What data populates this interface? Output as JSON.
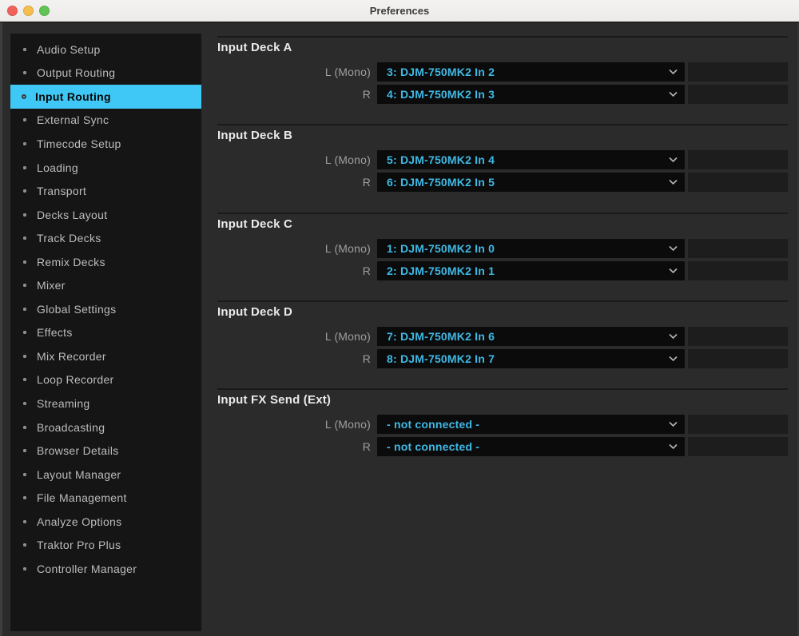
{
  "window": {
    "title": "Preferences"
  },
  "titlebar": {
    "buttons": [
      {
        "name": "close"
      },
      {
        "name": "minimize"
      },
      {
        "name": "zoom"
      }
    ]
  },
  "icons": {
    "dropdown": "chevron-down-icon",
    "sidebar_bullet": "dot",
    "sidebar_selected_bullet": "ring"
  },
  "colors": {
    "accent": "#3FC8F5",
    "dropdown_text": "#3FB9E5",
    "traffic_red": "#F2605A",
    "traffic_yellow": "#F5BE4F",
    "traffic_green": "#61C454",
    "sidebar_bg": "#151515",
    "panel_bg": "#2B2B2B"
  },
  "sidebar": {
    "items": [
      {
        "label": "Audio Setup",
        "selected": false
      },
      {
        "label": "Output Routing",
        "selected": false
      },
      {
        "label": "Input Routing",
        "selected": true
      },
      {
        "label": "External Sync",
        "selected": false
      },
      {
        "label": "Timecode Setup",
        "selected": false
      },
      {
        "label": "Loading",
        "selected": false
      },
      {
        "label": "Transport",
        "selected": false
      },
      {
        "label": "Decks Layout",
        "selected": false
      },
      {
        "label": "Track Decks",
        "selected": false
      },
      {
        "label": "Remix Decks",
        "selected": false
      },
      {
        "label": "Mixer",
        "selected": false
      },
      {
        "label": "Global Settings",
        "selected": false
      },
      {
        "label": "Effects",
        "selected": false
      },
      {
        "label": "Mix Recorder",
        "selected": false
      },
      {
        "label": "Loop Recorder",
        "selected": false
      },
      {
        "label": "Streaming",
        "selected": false
      },
      {
        "label": "Broadcasting",
        "selected": false
      },
      {
        "label": "Browser Details",
        "selected": false
      },
      {
        "label": "Layout Manager",
        "selected": false
      },
      {
        "label": "File Management",
        "selected": false
      },
      {
        "label": "Analyze Options",
        "selected": false
      },
      {
        "label": "Traktor Pro Plus",
        "selected": false
      },
      {
        "label": "Controller Manager",
        "selected": false
      }
    ]
  },
  "content": {
    "sections": [
      {
        "title": "Input Deck A",
        "rows": [
          {
            "label": "L (Mono)",
            "value": "3: DJM-750MK2 In 2"
          },
          {
            "label": "R",
            "value": "4: DJM-750MK2 In 3"
          }
        ]
      },
      {
        "title": "Input Deck B",
        "rows": [
          {
            "label": "L (Mono)",
            "value": "5: DJM-750MK2 In 4"
          },
          {
            "label": "R",
            "value": "6: DJM-750MK2 In 5"
          }
        ]
      },
      {
        "title": "Input Deck C",
        "rows": [
          {
            "label": "L (Mono)",
            "value": "1: DJM-750MK2 In 0"
          },
          {
            "label": "R",
            "value": "2: DJM-750MK2 In 1"
          }
        ]
      },
      {
        "title": "Input Deck D",
        "rows": [
          {
            "label": "L (Mono)",
            "value": "7: DJM-750MK2 In 6"
          },
          {
            "label": "R",
            "value": "8: DJM-750MK2 In 7"
          }
        ]
      },
      {
        "title": "Input FX Send (Ext)",
        "rows": [
          {
            "label": "L (Mono)",
            "value": "- not connected -"
          },
          {
            "label": "R",
            "value": "- not connected -"
          }
        ]
      }
    ]
  }
}
